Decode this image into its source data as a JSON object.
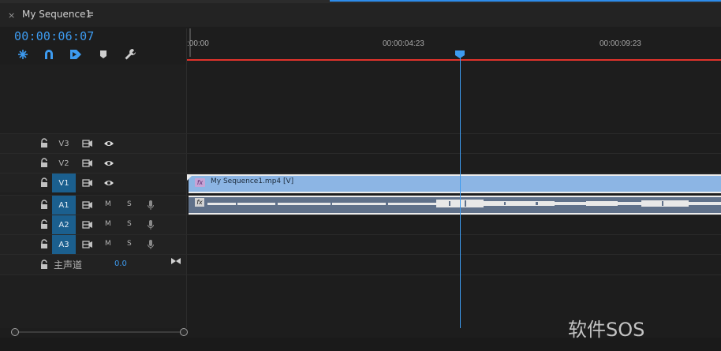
{
  "panel": {
    "close_icon": "×",
    "sequence_title": "My Sequence1",
    "menu_icon": "≡",
    "timecode": "00:00:06:07"
  },
  "toolbar": {
    "tools": [
      {
        "name": "snap-icon"
      },
      {
        "name": "linked-selection-icon"
      },
      {
        "name": "insert-tool-icon"
      },
      {
        "name": "marker-icon"
      },
      {
        "name": "wrench-icon"
      }
    ]
  },
  "ruler": {
    "labels": [
      ":00:00",
      "00:00:04:23",
      "00:00:09:23"
    ]
  },
  "tracks": {
    "video": [
      {
        "label": "V3",
        "active": false
      },
      {
        "label": "V2",
        "active": false
      },
      {
        "label": "V1",
        "active": true
      }
    ],
    "audio": [
      {
        "label": "A1",
        "m": "M",
        "s": "S"
      },
      {
        "label": "A2",
        "m": "M",
        "s": "S"
      },
      {
        "label": "A3",
        "m": "M",
        "s": "S"
      }
    ],
    "master": {
      "label": "主声道",
      "value": "0.0"
    }
  },
  "clips": {
    "video_clip_name": "My Sequence1.mp4 [V]",
    "fx_badge": "fx"
  },
  "colors": {
    "accent": "#3d9bf0",
    "playhead": "#3d9bf0",
    "work_area": "#e0322b",
    "video_clip": "#8cb5e4",
    "audio_clip": "#60718a",
    "track_target": "#1b5f8e"
  },
  "watermark": "软件SOS"
}
